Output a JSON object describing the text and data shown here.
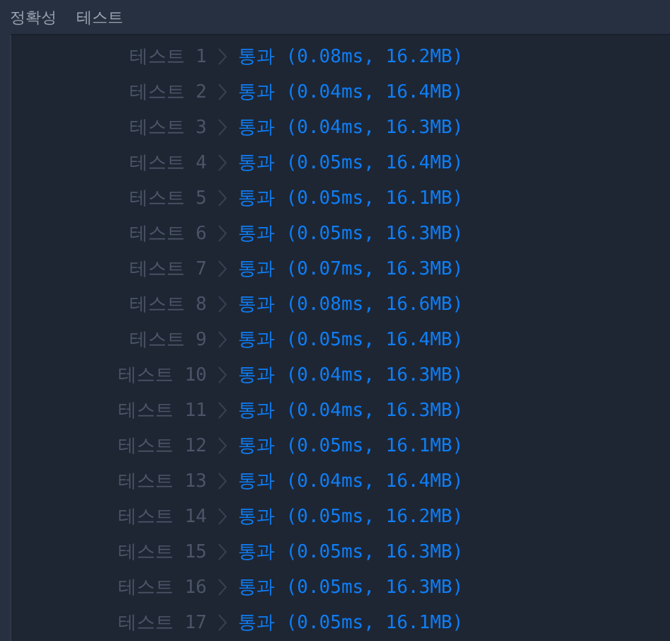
{
  "header": {
    "labels": [
      "정확성",
      "테스트"
    ]
  },
  "tests": [
    {
      "label": "테스트 1",
      "result": "통과 (0.08ms, 16.2MB)"
    },
    {
      "label": "테스트 2",
      "result": "통과 (0.04ms, 16.4MB)"
    },
    {
      "label": "테스트 3",
      "result": "통과 (0.04ms, 16.3MB)"
    },
    {
      "label": "테스트 4",
      "result": "통과 (0.05ms, 16.4MB)"
    },
    {
      "label": "테스트 5",
      "result": "통과 (0.05ms, 16.1MB)"
    },
    {
      "label": "테스트 6",
      "result": "통과 (0.05ms, 16.3MB)"
    },
    {
      "label": "테스트 7",
      "result": "통과 (0.07ms, 16.3MB)"
    },
    {
      "label": "테스트 8",
      "result": "통과 (0.08ms, 16.6MB)"
    },
    {
      "label": "테스트 9",
      "result": "통과 (0.05ms, 16.4MB)"
    },
    {
      "label": "테스트 10",
      "result": "통과 (0.04ms, 16.3MB)"
    },
    {
      "label": "테스트 11",
      "result": "통과 (0.04ms, 16.3MB)"
    },
    {
      "label": "테스트 12",
      "result": "통과 (0.05ms, 16.1MB)"
    },
    {
      "label": "테스트 13",
      "result": "통과 (0.04ms, 16.4MB)"
    },
    {
      "label": "테스트 14",
      "result": "통과 (0.05ms, 16.2MB)"
    },
    {
      "label": "테스트 15",
      "result": "통과 (0.05ms, 16.3MB)"
    },
    {
      "label": "테스트 16",
      "result": "통과 (0.05ms, 16.3MB)"
    },
    {
      "label": "테스트 17",
      "result": "통과 (0.05ms, 16.1MB)"
    }
  ]
}
